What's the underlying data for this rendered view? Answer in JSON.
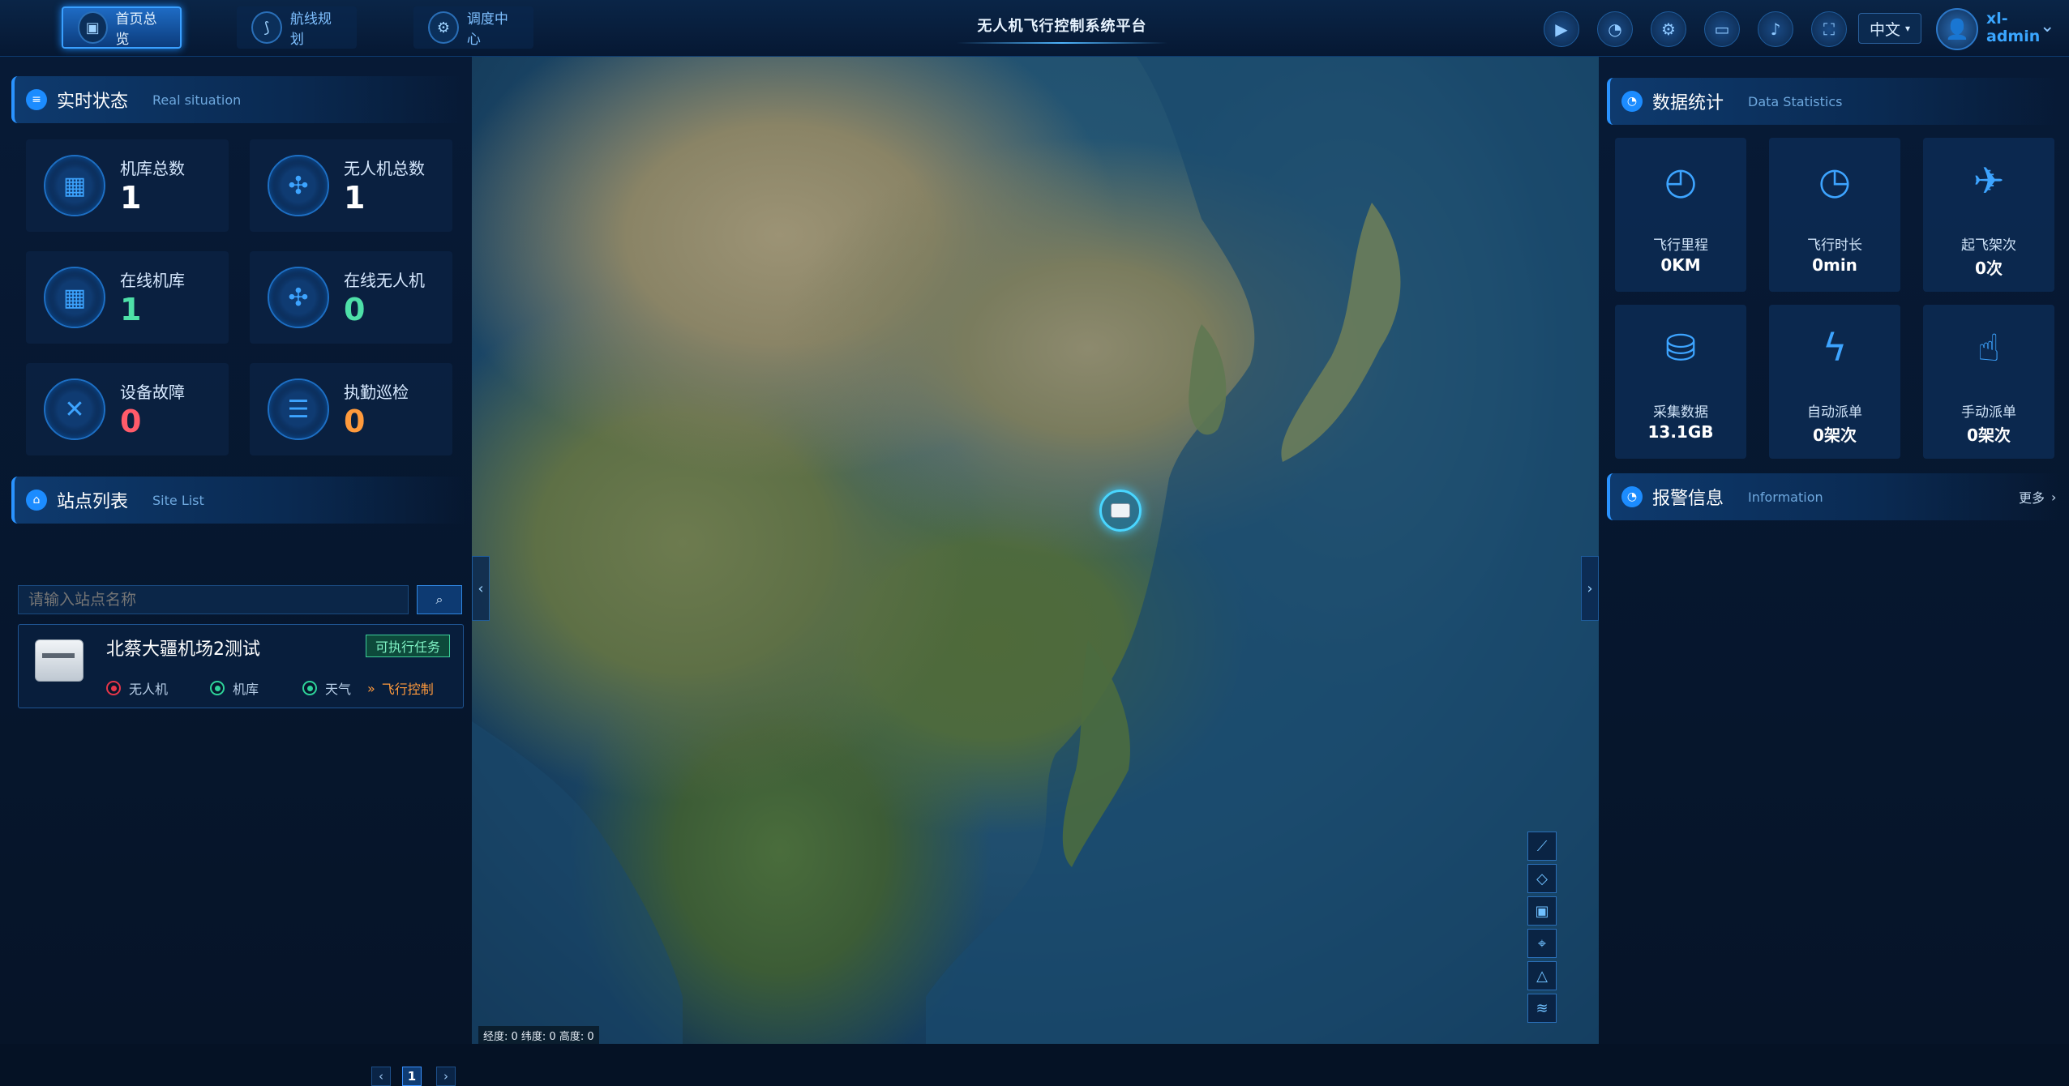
{
  "nav": {
    "tabs": [
      {
        "label": "首页总览",
        "icon": "dashboard-icon",
        "active": true
      },
      {
        "label": "航线规划",
        "icon": "route-icon",
        "active": false
      },
      {
        "label": "调度中心",
        "icon": "dispatch-icon",
        "active": false
      }
    ]
  },
  "app": {
    "title": "无人机飞行控制系统平台"
  },
  "header": {
    "icons": [
      "video-icon",
      "clock-icon",
      "settings-icon",
      "monitor-icon",
      "bell-icon",
      "fullscreen-icon"
    ],
    "language": "中文",
    "user": "xl-admin"
  },
  "realtime": {
    "title": "实时状态",
    "subtitle": "Real situation",
    "stats": [
      {
        "label": "机库总数",
        "value": "1",
        "color": "#ffffff",
        "icon": "hangar-icon"
      },
      {
        "label": "无人机总数",
        "value": "1",
        "color": "#ffffff",
        "icon": "drone-icon"
      },
      {
        "label": "在线机库",
        "value": "1",
        "color": "#4ee0a8",
        "icon": "hangar-icon"
      },
      {
        "label": "在线无人机",
        "value": "0",
        "color": "#4ee0a8",
        "icon": "drone-icon"
      },
      {
        "label": "设备故障",
        "value": "0",
        "color": "#ff5b6a",
        "icon": "tools-icon"
      },
      {
        "label": "执勤巡检",
        "value": "0",
        "color": "#ff9a3c",
        "icon": "patrol-icon"
      }
    ]
  },
  "sites": {
    "title": "站点列表",
    "subtitle": "Site List",
    "search_placeholder": "请输入站点名称",
    "items": [
      {
        "name": "北蔡大疆机场2测试",
        "badge": "可执行任务",
        "drone_label": "无人机",
        "drone_status_color": "#e5364a",
        "hangar_label": "机库",
        "hangar_status_color": "#2ed39a",
        "weather_label": "天气",
        "weather_status_color": "#2ed39a",
        "control_label": "飞行控制"
      }
    ],
    "pagination": {
      "current": "1"
    }
  },
  "map": {
    "coords_label": "经度: 0  纬度: 0  高度: 0",
    "tools": [
      "ruler-icon",
      "polygon-icon",
      "area-icon",
      "navigate-icon",
      "terrain-icon",
      "layers-icon"
    ]
  },
  "statistics": {
    "title": "数据统计",
    "subtitle": "Data Statistics",
    "cards": [
      {
        "label": "飞行里程",
        "value": "0KM",
        "icon": "speedometer-icon"
      },
      {
        "label": "飞行时长",
        "value": "0min",
        "icon": "clock-icon"
      },
      {
        "label": "起飞架次",
        "value": "0次",
        "icon": "takeoff-icon"
      },
      {
        "label": "采集数据",
        "value": "13.1GB",
        "icon": "database-icon"
      },
      {
        "label": "自动派单",
        "value": "0架次",
        "icon": "lightning-icon"
      },
      {
        "label": "手动派单",
        "value": "0架次",
        "icon": "hand-pointer-icon"
      }
    ]
  },
  "alarm": {
    "title": "报警信息",
    "subtitle": "Information",
    "more": "更多"
  }
}
